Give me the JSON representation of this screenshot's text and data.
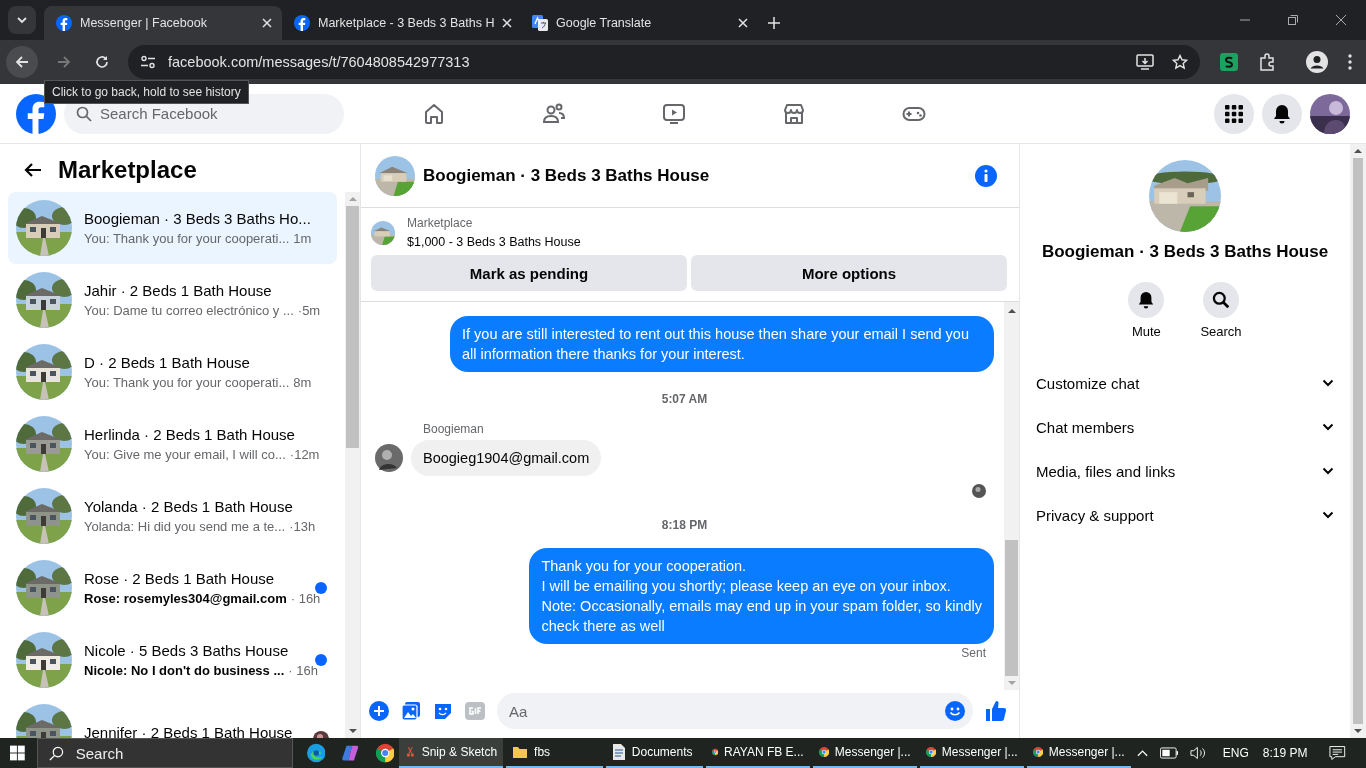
{
  "browser": {
    "tabs": [
      {
        "title": "Messenger | Facebook",
        "kind": "facebook",
        "selected": true
      },
      {
        "title": "Marketplace - 3 Beds 3 Baths H",
        "kind": "facebook",
        "selected": false
      },
      {
        "title": "Google Translate",
        "kind": "translate",
        "selected": false
      }
    ],
    "url": "facebook.com/messages/t/7604808542977313",
    "tooltip": "Click to go back, hold to see history"
  },
  "topbar": {
    "search": {
      "placeholder": "Search Facebook"
    },
    "nav": [
      {
        "kind": "home"
      },
      {
        "kind": "friends"
      },
      {
        "kind": "watch"
      },
      {
        "kind": "marketplace"
      },
      {
        "kind": "gaming"
      }
    ]
  },
  "sidebar": {
    "title": "Marketplace",
    "conversations": [
      {
        "name": "Boogieman · 3 Beds 3 Baths Ho...",
        "preview": "You: Thank you for your cooperati...",
        "time": "1m",
        "selected": true,
        "unread": false,
        "read_receipt": false
      },
      {
        "name": "Jahir · 2 Beds 1 Bath House",
        "preview": "You: Dame tu correo electrónico y ...",
        "time": "·5m",
        "selected": false,
        "unread": false,
        "read_receipt": false
      },
      {
        "name": "D · 2 Beds 1 Bath House",
        "preview": "You: Thank you for your cooperati...",
        "time": "8m",
        "selected": false,
        "unread": false,
        "read_receipt": false
      },
      {
        "name": "Herlinda · 2 Beds 1 Bath House",
        "preview": "You: Give me your email, I will co...",
        "time": "·12m",
        "selected": false,
        "unread": false,
        "read_receipt": false
      },
      {
        "name": "Yolanda · 2 Beds 1 Bath House",
        "preview": "Yolanda: Hi did you send me a te...",
        "time": "·13h",
        "selected": false,
        "unread": false,
        "read_receipt": false
      },
      {
        "name": "Rose · 2 Beds 1 Bath House",
        "preview": "Rose: rosemyles304@gmail.com",
        "time": "· 16h",
        "selected": false,
        "unread": true,
        "read_receipt": false
      },
      {
        "name": "Nicole · 5 Beds 3 Baths House",
        "preview": "Nicole: No I don't do business ...",
        "time": "· 16h",
        "selected": false,
        "unread": true,
        "read_receipt": false
      },
      {
        "name": "Jennifer · 2 Beds 1 Bath House",
        "selected": false,
        "unread": false,
        "read_receipt": true
      }
    ]
  },
  "chat": {
    "title": "Boogieman · 3 Beds 3 Baths House",
    "listing": {
      "label": "Marketplace",
      "title": "$1,000 - 3 Beds 3 Baths House",
      "buttons": [
        "Mark as pending",
        "More options"
      ]
    },
    "messages": [
      {
        "kind": "outgoing",
        "text": "If you are still interested to rent out this house then share your email  I send you all information there thanks for your interest."
      },
      {
        "kind": "timestamp",
        "text": "5:07 AM"
      },
      {
        "kind": "incoming",
        "sender": "Boogieman",
        "text": "Boogieg1904@gmail.com"
      },
      {
        "kind": "seen"
      },
      {
        "kind": "timestamp",
        "text": "8:18 PM"
      },
      {
        "kind": "outgoing",
        "text": "Thank you for your cooperation.\nI will be emailing you shortly; please keep an eye on your inbox.\nNote: Occasionally, emails may end up in your spam folder, so kindly\ncheck there as well"
      },
      {
        "kind": "status",
        "text": "Sent"
      }
    ],
    "composer": {
      "placeholder": "Aa"
    }
  },
  "details": {
    "name": "Boogieman · 3 Beds 3 Baths House",
    "actions": [
      {
        "kind": "mute",
        "label": "Mute"
      },
      {
        "kind": "search",
        "label": "Search"
      }
    ],
    "sections": [
      {
        "label": "Customize chat",
        "expanded": false
      },
      {
        "label": "Chat members",
        "expanded": false
      },
      {
        "label": "Media, files and links",
        "expanded": false
      },
      {
        "label": "Privacy & support",
        "expanded": false
      }
    ]
  },
  "taskbar": {
    "search": {
      "placeholder": "Search"
    },
    "pinned": [
      {
        "kind": "edge"
      },
      {
        "kind": "copilot"
      },
      {
        "kind": "chrome"
      }
    ],
    "windows": [
      {
        "label": "Snip & Sketch",
        "kind": "snip",
        "selected": true
      },
      {
        "label": "fbs",
        "kind": "folder",
        "selected": false
      },
      {
        "label": "Documents",
        "kind": "document",
        "selected": false
      },
      {
        "label": "RAYAN FB E...",
        "kind": "chrome",
        "selected": false
      },
      {
        "label": "Messenger |...",
        "kind": "chrome",
        "selected": false
      },
      {
        "label": "Messenger |...",
        "kind": "chrome",
        "selected": false
      },
      {
        "label": "Messenger |...",
        "kind": "chrome",
        "selected": false
      }
    ],
    "language": "ENG",
    "time": "8:19 PM"
  }
}
